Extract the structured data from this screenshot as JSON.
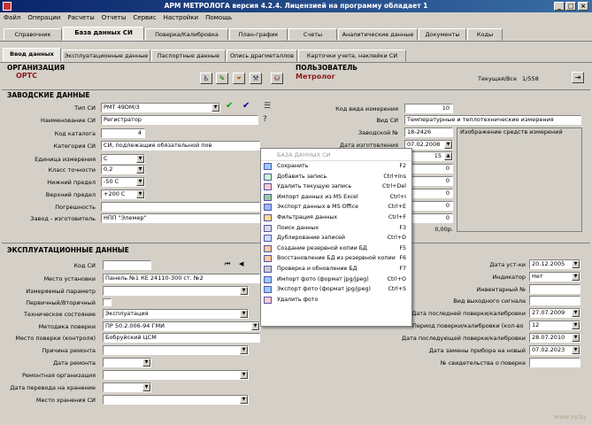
{
  "window": {
    "title": "АРМ МЕТРОЛОГА версия 4.2.4. Лицензией на программу обладает 1"
  },
  "menu": [
    "Файл",
    "Операции",
    "Расчеты",
    "Отчеты",
    "Сервис",
    "Настройки",
    "Помощь"
  ],
  "tabs": [
    "Справочник",
    "База данных СИ",
    "Поверка/Калибровка",
    "План-график",
    "Счеты",
    "Аналитические данные",
    "Документы",
    "Коды"
  ],
  "subtabs": [
    "Ввод данных",
    "Эксплуатационные данные",
    "Паспортные данные",
    "Опись драгметаллов",
    "Карточки учета, наклейки СИ"
  ],
  "org": {
    "label": "ОРГАНИЗАЦИЯ",
    "value": "ОРТС"
  },
  "user": {
    "label": "ПОЛЬЗОВАТЕЛЬ",
    "value": "Метролог",
    "status": "Текущая/Все",
    "count": "1/558"
  },
  "factory": {
    "title": "ЗАВОДСКИЕ ДАННЫЕ",
    "type_label": "Тип СИ",
    "type_value": "РМТ 49DM/3",
    "name_label": "Наименование СИ",
    "name_value": "Регистратор",
    "catalog_label": "Код каталога",
    "catalog_value": "4",
    "category_label": "Категория СИ",
    "category_value": "СИ, подлежащие обязательной пов",
    "unit_label": "Единица измерения",
    "unit_value": "С",
    "accuracy_label": "Класс точности",
    "accuracy_value": "0,2",
    "low_label": "Нижний предел",
    "low_value": "-50 С",
    "high_label": "Верхний предел",
    "high_value": "+200 С",
    "error_label": "Погрешность",
    "error_value": "",
    "maker_label": "Завод - изготовитель",
    "maker_value": "НПП \"Элемер\"",
    "kind_code_label": "Код вида измерения",
    "kind_code_value": "10",
    "kind_label": "Вид СИ",
    "kind_value": "Температурные и теплотехнические измерения",
    "serial_label": "Заводской №",
    "serial_value": "18-2426",
    "made_label": "Дата изготовления",
    "made_value": "07.02.2008",
    "spinner_value": "15",
    "zeros": [
      "0",
      "0",
      "0",
      "0",
      "0"
    ],
    "amount": "0,00р.",
    "extra_label": "Изображение средств измерений"
  },
  "ops": {
    "title": "ЭКСПЛУАТАЦИОННЫЕ ДАННЫЕ",
    "code_label": "Код СИ",
    "code_value": "",
    "place_label": "Место установки",
    "place_value": "Панель №1 КЕ 24110-300 ст. №2",
    "param_label": "Измеряемый параметр",
    "param_value": "",
    "primary_label": "Первичный/Вторичный",
    "primary_value": "",
    "tech_label": "Техническое состояние",
    "tech_value": "Эксплуатация",
    "method_label": "Методика поверки",
    "method_value": "ПР 50.2.006-94 ГМИ",
    "vplace_label": "Место поверки (контроля)",
    "vplace_value": "Бобруйский ЦСМ",
    "reason_label": "Причина ремонта",
    "reason_value": "",
    "repdate_label": "Дата ремонта",
    "repdate_value": "",
    "reporg_label": "Ремонтная организация",
    "reporg_value": "",
    "store_date_label": "Дата перевода на хранение",
    "store_date_value": "",
    "store_place_label": "Место хранения СИ",
    "store_place_value": "",
    "nav_symbols": [
      "⏮",
      "◀"
    ],
    "start_label": "Дата уст-ки",
    "start_value": "20.12.2005",
    "indicator_label": "Индикатор",
    "indicator_value": "Нет",
    "inv_label": "Инвентарный №",
    "inv_value": "",
    "output_label": "Вид выходного сигнала",
    "output_value": "",
    "last_label": "Дата последней поверки/калибровки",
    "last_value": "27.07.2009",
    "interval_label": "Период поверки/калибровки (кол-во месяцев)",
    "interval_value": "12",
    "last2_label": "Дата последующей поверки/калибровки",
    "last2_value": "28.07.2010",
    "replace_label": "Дата замены прибора на новый",
    "replace_value": "07.02.2023",
    "cert_label": "№ свидетельства о поверке",
    "cert_value": ""
  },
  "context_menu": {
    "header": "БАЗА ДАННЫХ СИ",
    "items": [
      {
        "label": "Сохранить",
        "shortcut": "F2"
      },
      {
        "label": "Добавить запись",
        "shortcut": "Ctrl+Ins"
      },
      {
        "label": "Удалить текущую запись",
        "shortcut": "Ctrl+Del"
      },
      {
        "label": "Импорт данных из MS Excel",
        "shortcut": "Ctrl+I"
      },
      {
        "label": "Экспорт данных в MS Office",
        "shortcut": "Ctrl+E"
      },
      {
        "label": "Фильтрация данных",
        "shortcut": "Ctrl+F"
      },
      {
        "label": "Поиск данных",
        "shortcut": "F3"
      },
      {
        "label": "Дублирование записей",
        "shortcut": "Ctrl+D"
      },
      {
        "label": "Создание резервной копии БД",
        "shortcut": "F5"
      },
      {
        "label": "Восстановление БД из резервной копии",
        "shortcut": "F6"
      },
      {
        "label": "Проверка и обновление БД",
        "shortcut": "F7"
      },
      {
        "label": "Импорт фото (формат jpg/jpeg)",
        "shortcut": "Ctrl+O"
      },
      {
        "label": "Экспорт фото (формат jpg/jpeg)",
        "shortcut": "Ctrl+S"
      },
      {
        "label": "Удалить фото",
        "shortcut": ""
      }
    ]
  },
  "watermark": "www.ay.by",
  "colors": {
    "title_bar": "#0a246a",
    "org_text": "#8b1a1a",
    "form_bg": "#d4d0c8"
  }
}
